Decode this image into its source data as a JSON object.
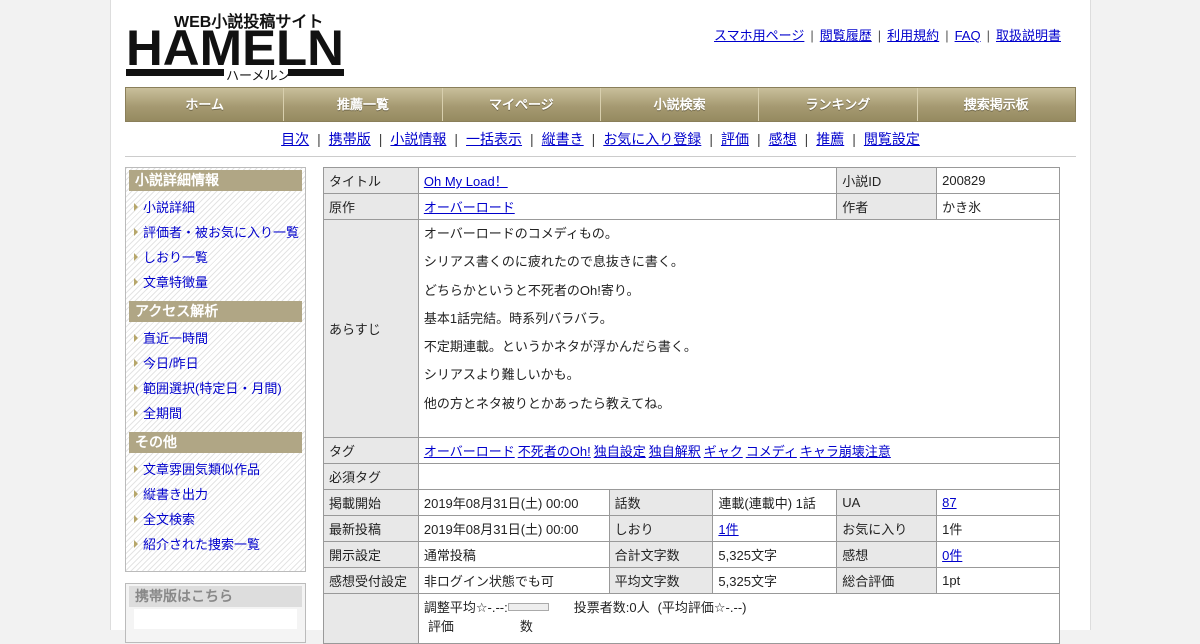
{
  "header": {
    "logo_main": "HAMELN",
    "logo_sub": "WEB小説投稿サイト",
    "logo_kana": "ハーメルン",
    "top_links": [
      "スマホ用ページ",
      "閲覧履歴",
      "利用規約",
      "FAQ",
      "取扱説明書"
    ]
  },
  "main_nav": [
    "ホーム",
    "推薦一覧",
    "マイページ",
    "小説検索",
    "ランキング",
    "捜索掲示板"
  ],
  "sub_nav": [
    "目次",
    "携帯版",
    "小説情報",
    "一括表示",
    "縦書き",
    "お気に入り登録",
    "評価",
    "感想",
    "推薦",
    "閲覧設定"
  ],
  "sidebar": {
    "sections": [
      {
        "title": "小説詳細情報",
        "items": [
          "小説詳細",
          "評価者・被お気に入り一覧",
          "しおり一覧",
          "文章特徴量"
        ]
      },
      {
        "title": "アクセス解析",
        "items": [
          "直近一時間",
          "今日/昨日",
          "範囲選択(特定日・月間)",
          "全期間"
        ]
      },
      {
        "title": "その他",
        "items": [
          "文章雰囲気類似作品",
          "縦書き出力",
          "全文検索",
          "紹介された捜索一覧"
        ]
      }
    ],
    "mobile_title": "携帯版はこちら"
  },
  "info": {
    "title_label": "タイトル",
    "title": "Oh My Load！",
    "id_label": "小説ID",
    "id": "200829",
    "original_label": "原作",
    "original": "オーバーロード",
    "author_label": "作者",
    "author": "かき氷",
    "synopsis_label": "あらすじ",
    "synopsis": [
      "オーバーロードのコメディもの。",
      "シリアス書くのに疲れたので息抜きに書く。",
      "どちらかというと不死者のOh!寄り。",
      "基本1話完結。時系列バラバラ。",
      "不定期連載。というかネタが浮かんだら書く。",
      "シリアスより難しいかも。",
      "他の方とネタ被りとかあったら教えてね。"
    ],
    "tags_label": "タグ",
    "tags": [
      "オーバーロード",
      "不死者のOh!",
      "独自設定",
      "独自解釈",
      "ギャク",
      "コメディ",
      "キャラ崩壊注意"
    ],
    "required_tags_label": "必須タグ",
    "start_label": "掲載開始",
    "start": "2019年08月31日(土) 00:00",
    "episodes_label": "話数",
    "episodes": "連載(連載中) 1話",
    "ua_label": "UA",
    "ua": "87",
    "latest_label": "最新投稿",
    "latest": "2019年08月31日(土) 00:00",
    "bookmark_label": "しおり",
    "bookmark": "1件",
    "fav_label": "お気に入り",
    "fav": "1件",
    "visibility_label": "開示設定",
    "visibility": "通常投稿",
    "total_chars_label": "合計文字数",
    "total_chars": "5,325文字",
    "comments_label": "感想",
    "comments": "0件",
    "accept_label": "感想受付設定",
    "accept": "非ログイン状態でも可",
    "avg_chars_label": "平均文字数",
    "avg_chars": "5,325文字",
    "overall_label": "総合評価",
    "overall": "1pt",
    "rating_avg_prefix": "調整平均☆-.--:",
    "rating_voters": "投票者数:0人",
    "rating_avg": "(平均評価☆-.--)",
    "rating_header_1": "評価",
    "rating_header_2": "数"
  }
}
